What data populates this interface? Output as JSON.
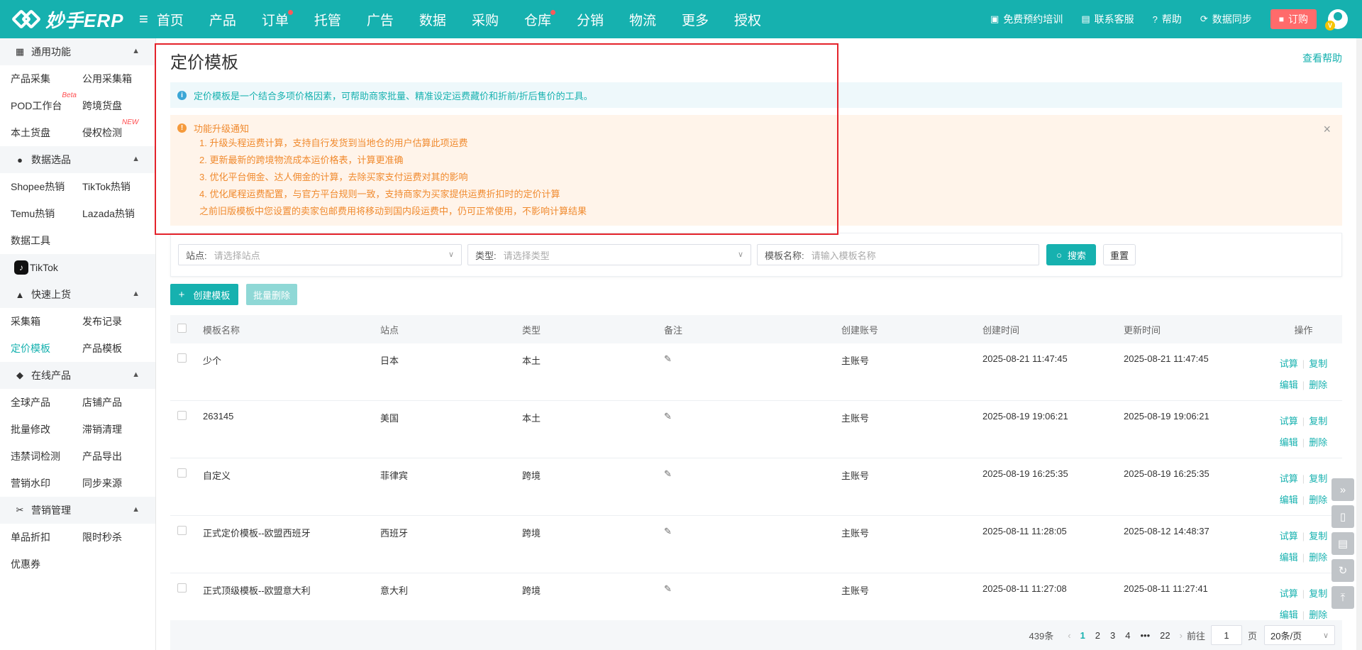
{
  "topbar": {
    "logo_text": "妙手ERP",
    "menu_icon": "hamburger-icon",
    "nav": [
      "首页",
      "产品",
      "订单",
      "托管",
      "广告",
      "数据",
      "采购",
      "仓库",
      "分销",
      "物流",
      "更多",
      "授权"
    ],
    "right": {
      "training": "免费预约培训",
      "service": "联系客服",
      "help": "帮助",
      "sync": "数据同步",
      "order": "订购",
      "vip_badge": "V"
    },
    "color": "#16b1af"
  },
  "sidebar": {
    "group_general": "通用功能",
    "general": [
      [
        "产品采集",
        "公用采集箱"
      ],
      [
        "POD工作台",
        "跨境货盘"
      ],
      [
        "本土货盘",
        "侵权检测"
      ]
    ],
    "beta_tag": "Beta",
    "new_tag": "NEW",
    "group_data": "数据选品",
    "data": [
      [
        "Shopee热销",
        "TikTok热销"
      ],
      [
        "Temu热销",
        "Lazada热销"
      ],
      [
        "数据工具",
        ""
      ]
    ],
    "tiktok": "TikTok",
    "tiktok_icon": "♪",
    "group_listing": "快速上货",
    "listing": [
      [
        "采集箱",
        "发布记录"
      ],
      [
        "定价模板",
        "产品模板"
      ]
    ],
    "group_online": "在线产品",
    "online": [
      [
        "全球产品",
        "店铺产品"
      ],
      [
        "批量修改",
        "滞销清理"
      ],
      [
        "违禁词检测",
        "产品导出"
      ],
      [
        "营销水印",
        "同步来源"
      ]
    ],
    "group_marketing": "营销管理",
    "marketing": [
      [
        "单品折扣",
        "限时秒杀"
      ],
      [
        "优惠券",
        ""
      ]
    ]
  },
  "main": {
    "title": "定价模板",
    "help_link": "查看帮助",
    "info": "定价模板是一个结合多项价格因素，可帮助商家批量、精准设定运费藏价和折前/折后售价的工具。",
    "notice_title": "功能升级通知",
    "notice_lines": [
      "1. 升级头程运费计算，支持自行发货到当地仓的用户估算此项运费",
      "2. 更新最新的跨境物流成本运价格表，计算更准确",
      "3. 优化平台佣金、达人佣金的计算，去除买家支付运费对其的影响",
      "4. 优化尾程运费配置，与官方平台规则一致，支持商家为买家提供运费折扣时的定价计算",
      "之前旧版模板中您设置的卖家包邮费用将移动到国内段运费中，仍可正常使用，不影响计算结果"
    ],
    "filter": {
      "site_label": "站点:",
      "site_ph": "请选择站点",
      "type_label": "类型:",
      "type_ph": "请选择类型",
      "name_label": "模板名称:",
      "name_ph": "请输入模板名称",
      "search": "搜索",
      "reset": "重置"
    },
    "create_btn": "创建模板",
    "batch_delete_btn": "批量删除",
    "columns": [
      "模板名称",
      "站点",
      "类型",
      "备注",
      "创建账号",
      "创建时间",
      "更新时间",
      "操作"
    ],
    "rows": [
      {
        "name": "少个",
        "site": "日本",
        "type": "本土",
        "account": "主账号",
        "created": "2025-08-21 11:47:45",
        "updated": "2025-08-21 11:47:45"
      },
      {
        "name": "263145",
        "site": "美国",
        "type": "本土",
        "account": "主账号",
        "created": "2025-08-19 19:06:21",
        "updated": "2025-08-19 19:06:21"
      },
      {
        "name": "自定义",
        "site": "菲律宾",
        "type": "跨境",
        "account": "主账号",
        "created": "2025-08-19 16:25:35",
        "updated": "2025-08-19 16:25:35"
      },
      {
        "name": "正式定价模板--欧盟西班牙",
        "site": "西班牙",
        "type": "跨境",
        "account": "主账号",
        "created": "2025-08-11 11:28:05",
        "updated": "2025-08-12 14:48:37"
      },
      {
        "name": "正式顶级模板--欧盟意大利",
        "site": "意大利",
        "type": "跨境",
        "account": "主账号",
        "created": "2025-08-11 11:27:08",
        "updated": "2025-08-11 11:27:41"
      }
    ],
    "ops": {
      "trial": "试算",
      "copy": "复制",
      "edit": "编辑",
      "delete": "删除"
    },
    "pager": {
      "total": "439条",
      "pages": [
        "1",
        "2",
        "3",
        "4",
        "•••",
        "22"
      ],
      "goto": "前往",
      "goto_value": "1",
      "page_unit": "页",
      "size": "20条/页"
    }
  }
}
